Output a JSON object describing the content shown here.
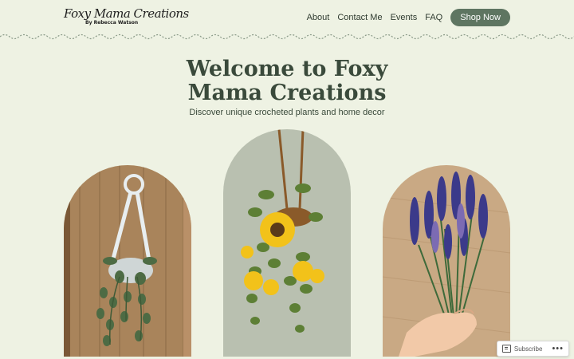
{
  "header": {
    "logo_title": "Foxy Mama Creations",
    "logo_subtitle": "By Rebecca Watson",
    "nav": [
      {
        "label": "About"
      },
      {
        "label": "Contact Me"
      },
      {
        "label": "Events"
      },
      {
        "label": "FAQ"
      }
    ],
    "shop_label": "Shop Now"
  },
  "hero": {
    "title_line1": "Welcome to Foxy",
    "title_line2": "Mama Creations",
    "subtitle": "Discover unique crocheted plants and home decor"
  },
  "gallery": [
    {
      "image": "crocheted-hanging-plant"
    },
    {
      "image": "crocheted-hanging-sunflowers"
    },
    {
      "image": "crocheted-lavender-bouquet"
    }
  ],
  "subscribe": {
    "label": "Subscribe",
    "more": "•••"
  },
  "colors": {
    "background": "#eef2e3",
    "accent": "#5e7561",
    "text": "#2c3a2e"
  }
}
